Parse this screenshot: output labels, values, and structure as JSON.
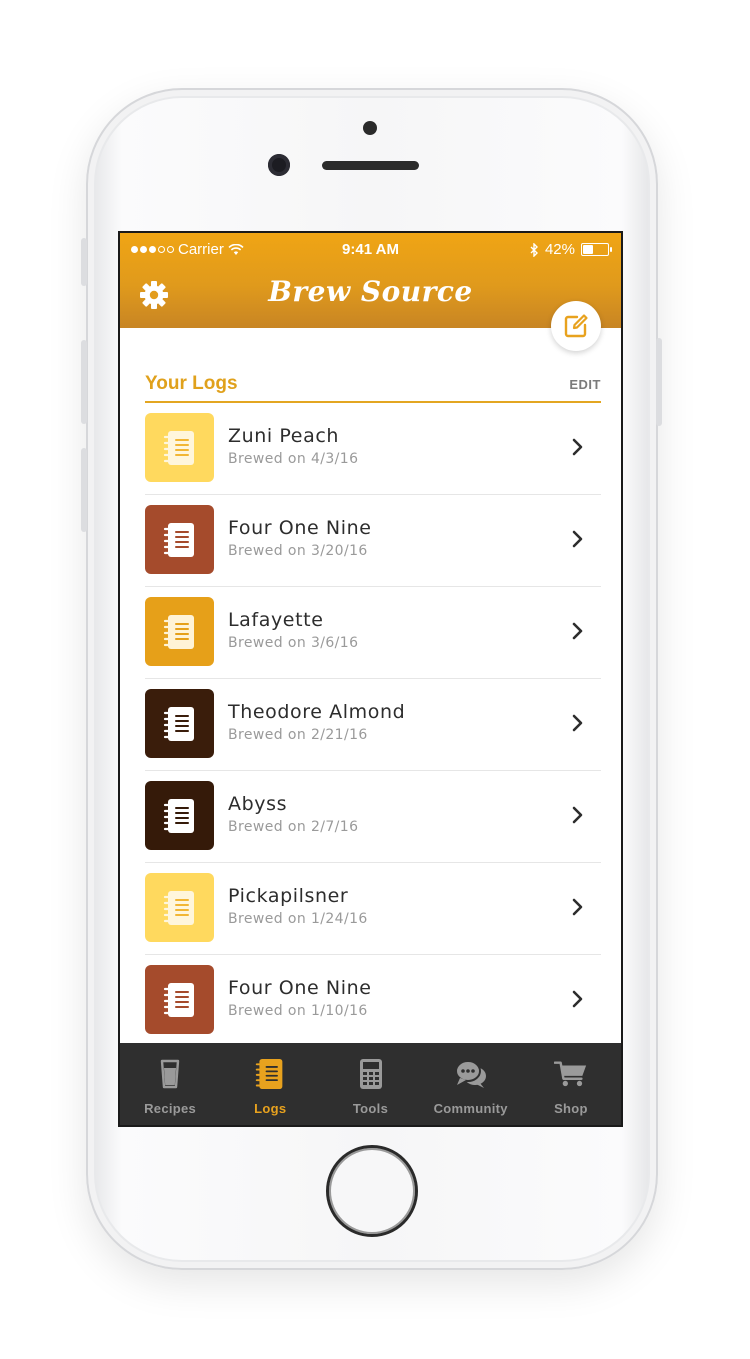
{
  "status_bar": {
    "carrier": "Carrier",
    "time": "9:41 AM",
    "battery": "42%",
    "battery_level": 0.42
  },
  "header": {
    "title": "Brew Source",
    "settings_icon": "gear-icon",
    "compose_icon": "compose-icon"
  },
  "section": {
    "title": "Your Logs",
    "edit_label": "EDIT"
  },
  "logs": [
    {
      "name": "Zuni Peach",
      "date": "Brewed on 4/3/16",
      "color": "#ffd95e",
      "icon_color": "#fff6dc",
      "line_color": "#f2b634"
    },
    {
      "name": "Four One Nine",
      "date": "Brewed on 3/20/16",
      "color": "#a54b2c",
      "icon_color": "#ffffff",
      "line_color": "#a54b2c"
    },
    {
      "name": "Lafayette",
      "date": "Brewed on 3/6/16",
      "color": "#e6a019",
      "icon_color": "#fff3d6",
      "line_color": "#e6a019"
    },
    {
      "name": "Theodore Almond",
      "date": "Brewed on 2/21/16",
      "color": "#3a1d0b",
      "icon_color": "#ffffff",
      "line_color": "#3a1d0b"
    },
    {
      "name": "Abyss",
      "date": "Brewed on 2/7/16",
      "color": "#351a09",
      "icon_color": "#ffffff",
      "line_color": "#351a09"
    },
    {
      "name": "Pickapilsner",
      "date": "Brewed on 1/24/16",
      "color": "#ffd95e",
      "icon_color": "#fff6dc",
      "line_color": "#f2b634"
    },
    {
      "name": "Four One Nine",
      "date": "Brewed on 1/10/16",
      "color": "#a54b2c",
      "icon_color": "#ffffff",
      "line_color": "#a54b2c"
    }
  ],
  "tabs": [
    {
      "label": "Recipes",
      "icon": "pint-glass-icon",
      "active": false
    },
    {
      "label": "Logs",
      "icon": "notebook-icon",
      "active": true
    },
    {
      "label": "Tools",
      "icon": "calculator-icon",
      "active": false
    },
    {
      "label": "Community",
      "icon": "chat-bubbles-icon",
      "active": false
    },
    {
      "label": "Shop",
      "icon": "shopping-cart-icon",
      "active": false
    }
  ],
  "colors": {
    "accent": "#e8a21e",
    "header_top": "#f0a514",
    "header_bottom": "#c88524",
    "tab_bar": "#2f2f2f",
    "tab_inactive": "#9a9a9a"
  }
}
